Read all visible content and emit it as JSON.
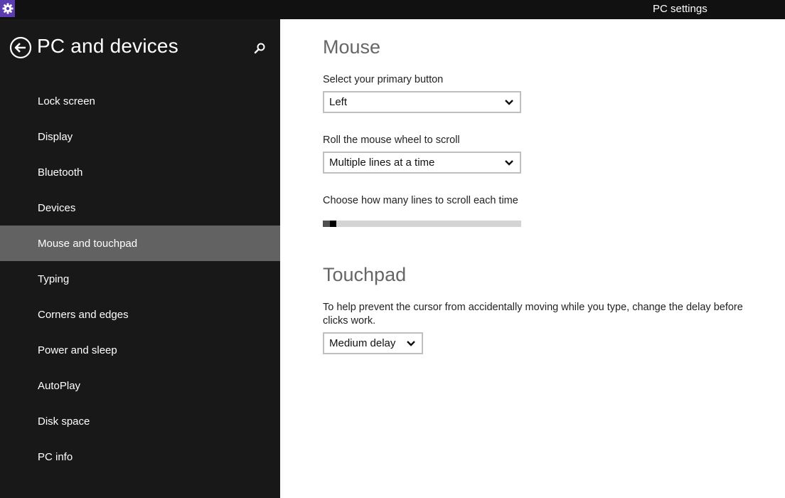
{
  "window": {
    "title": "PC settings",
    "app_icon": "gear-icon",
    "app_icon_color": "#5b3bb0"
  },
  "sidebar": {
    "title": "PC and devices",
    "back_icon": "back-arrow-circle-icon",
    "search_icon": "search-icon",
    "items": [
      {
        "label": "Lock screen",
        "active": false
      },
      {
        "label": "Display",
        "active": false
      },
      {
        "label": "Bluetooth",
        "active": false
      },
      {
        "label": "Devices",
        "active": false
      },
      {
        "label": "Mouse and touchpad",
        "active": true
      },
      {
        "label": "Typing",
        "active": false
      },
      {
        "label": "Corners and edges",
        "active": false
      },
      {
        "label": "Power and sleep",
        "active": false
      },
      {
        "label": "AutoPlay",
        "active": false
      },
      {
        "label": "Disk space",
        "active": false
      },
      {
        "label": "PC info",
        "active": false
      }
    ]
  },
  "mouse": {
    "heading": "Mouse",
    "primary_button": {
      "label": "Select your primary button",
      "value": "Left"
    },
    "wheel_scroll": {
      "label": "Roll the mouse wheel to scroll",
      "value": "Multiple lines at a time"
    },
    "lines_slider": {
      "label": "Choose how many lines to scroll each time",
      "value_fraction": 0.03
    }
  },
  "touchpad": {
    "heading": "Touchpad",
    "description": "To help prevent the cursor from accidentally moving while you type, change the delay before clicks work.",
    "delay": {
      "value": "Medium delay"
    }
  }
}
